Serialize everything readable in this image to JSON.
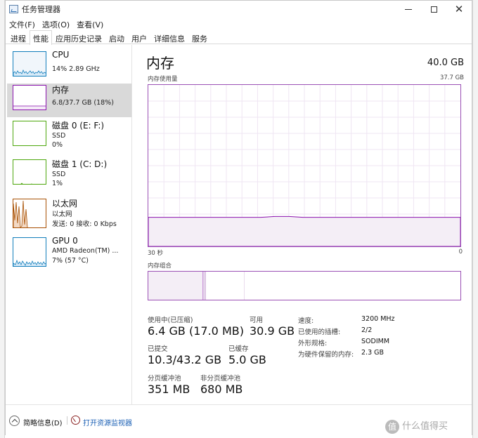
{
  "window": {
    "title": "任务管理器"
  },
  "menu": [
    {
      "label": "文件(F)"
    },
    {
      "label": "选项(O)"
    },
    {
      "label": "查看(V)"
    }
  ],
  "tabs": [
    {
      "label": "进程",
      "active": false
    },
    {
      "label": "性能",
      "active": true
    },
    {
      "label": "应用历史记录",
      "active": false
    },
    {
      "label": "启动",
      "active": false
    },
    {
      "label": "用户",
      "active": false
    },
    {
      "label": "详细信息",
      "active": false
    },
    {
      "label": "服务",
      "active": false
    }
  ],
  "sidebar": [
    {
      "title": "CPU",
      "sub1": "14% 2.89 GHz",
      "sub2": "",
      "color": "#117dbb",
      "selected": false
    },
    {
      "title": "内存",
      "sub1": "6.8/37.7 GB (18%)",
      "sub2": "",
      "color": "#8b12ae",
      "selected": true
    },
    {
      "title": "磁盘 0 (E: F:)",
      "sub1": "SSD",
      "sub2": "0%",
      "color": "#4da60c",
      "selected": false
    },
    {
      "title": "磁盘 1 (C: D:)",
      "sub1": "SSD",
      "sub2": "1%",
      "color": "#4da60c",
      "selected": false
    },
    {
      "title": "以太网",
      "sub1": "以太网",
      "sub2": "发送: 0 接收: 0 Kbps",
      "color": "#a74f01",
      "selected": false
    },
    {
      "title": "GPU 0",
      "sub1": "AMD Radeon(TM) ...",
      "sub2": "7% (57 °C)",
      "color": "#117dbb",
      "selected": false
    }
  ],
  "main": {
    "title": "内存",
    "total": "40.0 GB",
    "usage_label": "内存使用量",
    "usage_max": "37.7 GB",
    "time_left": "30 秒",
    "time_right": "0",
    "composition_label": "内存组合",
    "usage_percent": 18
  },
  "stats": {
    "in_use_label": "使用中(已压缩)",
    "in_use_value": "6.4 GB (17.0 MB)",
    "available_label": "可用",
    "available_value": "30.9 GB",
    "committed_label": "已提交",
    "committed_value": "10.3/43.2 GB",
    "cached_label": "已缓存",
    "cached_value": "5.0 GB",
    "paged_label": "分页缓冲池",
    "paged_value": "351 MB",
    "nonpaged_label": "非分页缓冲池",
    "nonpaged_value": "680 MB"
  },
  "specs": [
    {
      "label": "速度:",
      "value": "3200 MHz"
    },
    {
      "label": "已使用的插槽:",
      "value": "2/2"
    },
    {
      "label": "外形规格:",
      "value": "SODIMM"
    },
    {
      "label": "为硬件保留的内存:",
      "value": "2.3 GB"
    }
  ],
  "footer": {
    "summary": "简略信息(D)",
    "monitor": "打开资源监视器"
  },
  "watermark": {
    "badge": "值",
    "text": "什么值得买"
  },
  "colors": {
    "memory": "#8b12ae",
    "cpu": "#117dbb",
    "disk": "#4da60c",
    "ethernet": "#a74f01"
  }
}
